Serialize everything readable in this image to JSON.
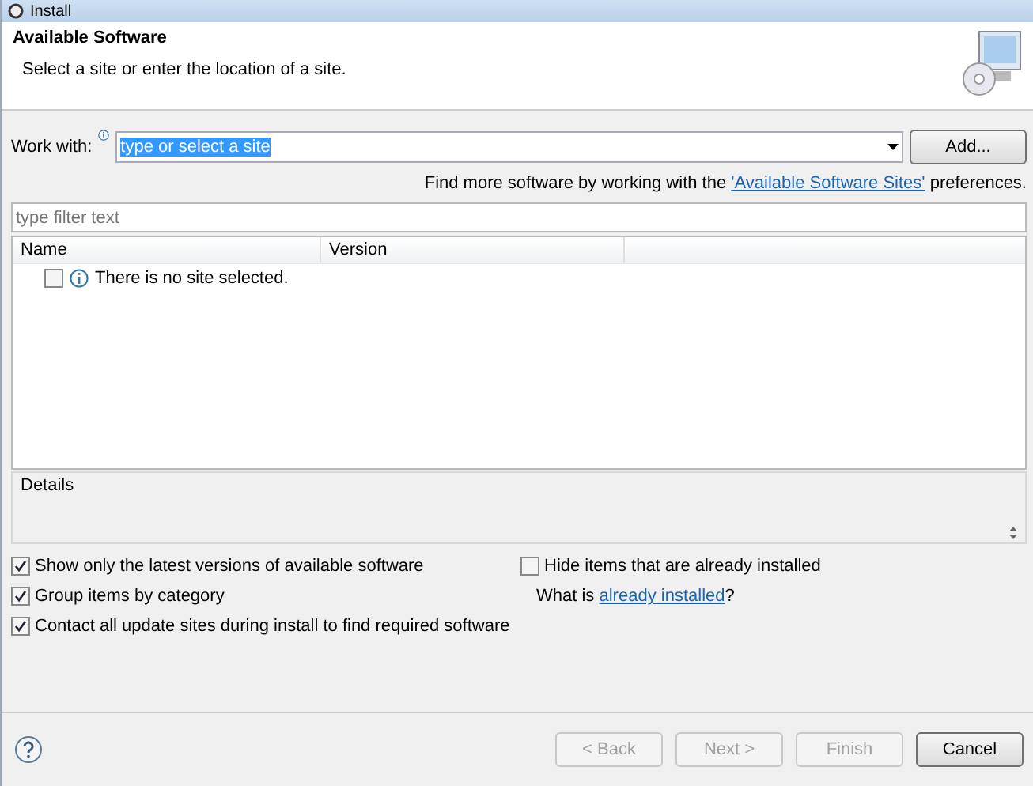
{
  "window": {
    "title": "Install"
  },
  "header": {
    "title": "Available Software",
    "subtitle": "Select a site or enter the location of a site."
  },
  "work_with": {
    "label": "Work with:",
    "value": "type or select a site",
    "add_button": "Add..."
  },
  "find_more": {
    "before": "Find more software by working with the",
    "link": "'Available Software Sites'",
    "after": "preferences."
  },
  "filter": {
    "placeholder": "type filter text"
  },
  "table": {
    "columns": [
      "Name",
      "Version"
    ],
    "rows": [
      {
        "text": "There is no site selected.",
        "checked": false
      }
    ]
  },
  "details": {
    "label": "Details"
  },
  "options_left": [
    {
      "label": "Show only the latest versions of available software",
      "checked": true
    },
    {
      "label": "Group items by category",
      "checked": true
    },
    {
      "label": "Contact all update sites during install to find required software",
      "checked": true
    }
  ],
  "options_right": {
    "hide": {
      "label": "Hide items that are already installed",
      "checked": false
    },
    "what_is": "What is",
    "link": "already installed",
    "after": "?"
  },
  "buttons": [
    {
      "label": "< Back",
      "disabled": true
    },
    {
      "label": "Next >",
      "disabled": true
    },
    {
      "label": "Finish",
      "disabled": true
    },
    {
      "label": "Cancel",
      "disabled": false
    }
  ]
}
